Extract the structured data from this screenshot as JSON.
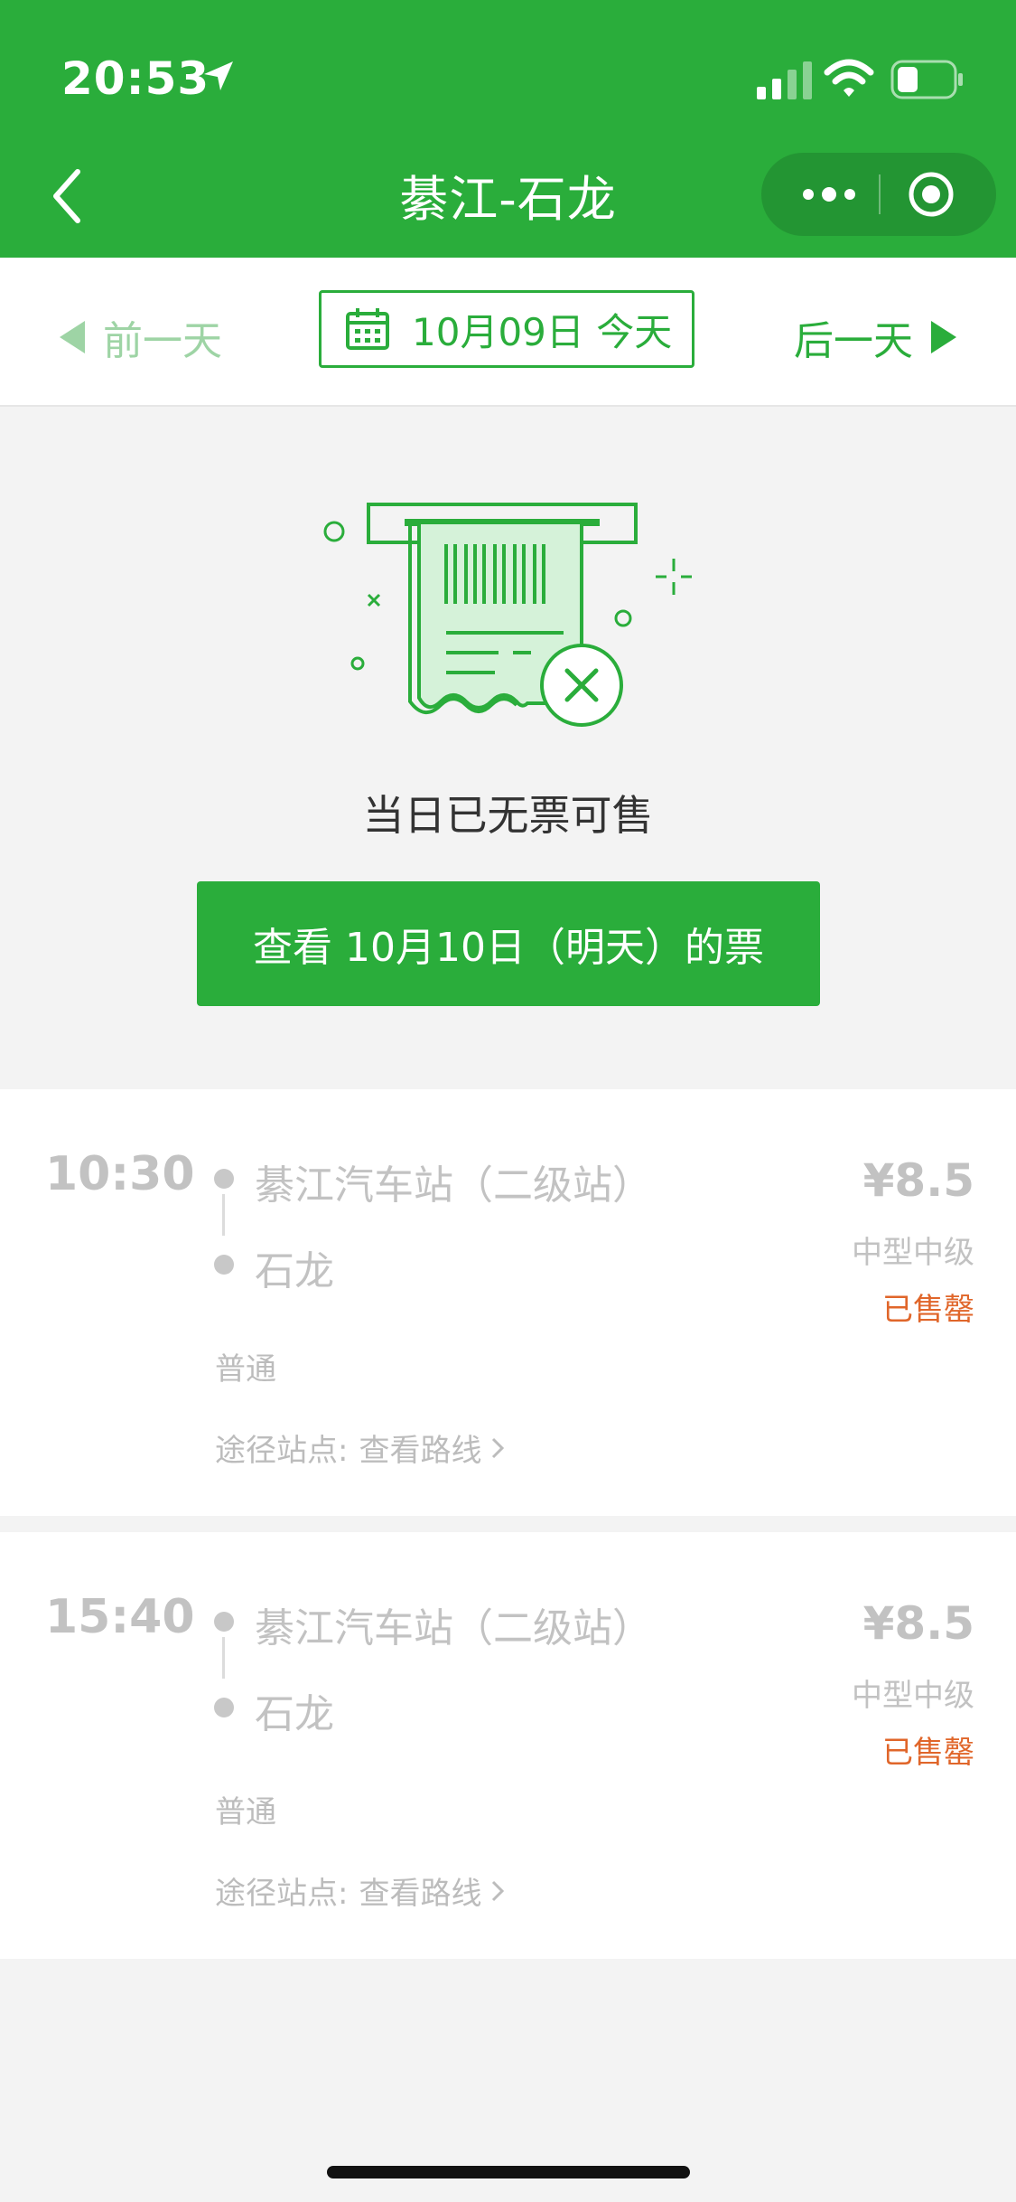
{
  "status_bar": {
    "time": "20:53"
  },
  "nav": {
    "title": "綦江-石龙"
  },
  "date_bar": {
    "prev_label": "前一天",
    "date_label": "10月09日 今天",
    "next_label": "后一天"
  },
  "empty_state": {
    "message": "当日已无票可售",
    "button_label": "查看 10月10日（明天）的票"
  },
  "trips": [
    {
      "time": "10:30",
      "from": "綦江汽车站（二级站）",
      "to": "石龙",
      "price": "¥8.5",
      "bus_type": "中型中级",
      "status": "已售罄",
      "class": "普通",
      "route_label": "途径站点:",
      "route_link": "查看路线"
    },
    {
      "time": "15:40",
      "from": "綦江汽车站（二级站）",
      "to": "石龙",
      "price": "¥8.5",
      "bus_type": "中型中级",
      "status": "已售罄",
      "class": "普通",
      "route_label": "途径站点:",
      "route_link": "查看路线"
    }
  ],
  "colors": {
    "brand": "#2aad3b",
    "sold_out": "#e0662a",
    "disabled_text": "#c2c2c2"
  },
  "icons": [
    "location-arrow-icon",
    "signal-icon",
    "wifi-icon",
    "battery-icon",
    "back-icon",
    "more-icon",
    "target-icon",
    "calendar-icon",
    "triangle-left-icon",
    "triangle-right-icon",
    "ticket-empty-icon",
    "chevron-right-icon"
  ]
}
